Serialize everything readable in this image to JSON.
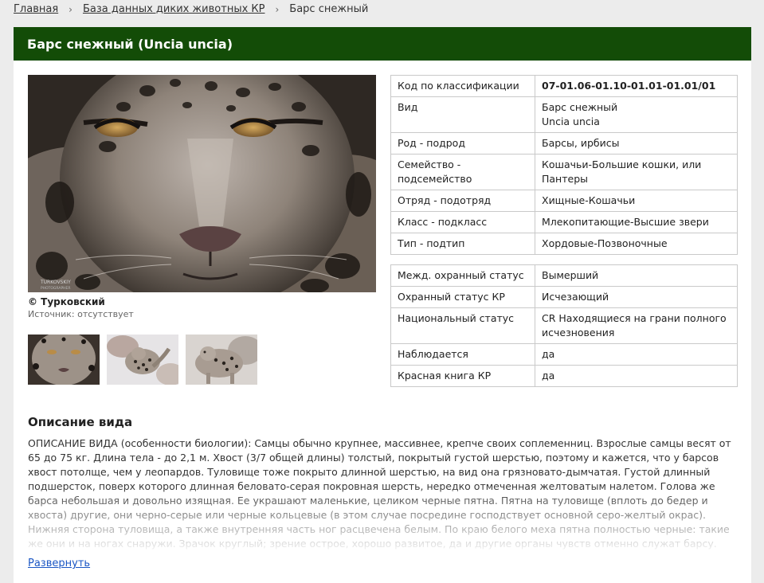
{
  "breadcrumb": {
    "home": "Главная",
    "database": "База данных диких животных КР",
    "current": "Барс снежный",
    "separator": "›"
  },
  "page_title": "Барс снежный (Uncia uncia)",
  "photo": {
    "subject": "snow-leopard",
    "watermark_line1": "TURKOVSKIY",
    "watermark_line2": "PHOTOGRAPHER",
    "author": "© Турковский",
    "source": "Источник: отсутствует",
    "thumbnails": [
      "snow-leopard-face",
      "snow-leopard-snow",
      "snow-leopard-walking"
    ]
  },
  "taxonomy": [
    {
      "key": "Код по классификации",
      "value": "07-01.06-01.10-01.01-01.01/01",
      "bold": true
    },
    {
      "key": "Вид",
      "value": "Барс снежный",
      "value2": "Uncia uncia"
    },
    {
      "key": "Род - подрод",
      "value": "Барсы, ирбисы"
    },
    {
      "key": "Семейство - подсемейство",
      "value": "Кошачьи-Большие кошки, или Пантеры"
    },
    {
      "key": "Отряд - подотряд",
      "value": "Хищные-Кошачьи"
    },
    {
      "key": "Класс - подкласс",
      "value": "Млекопитающие-Высшие звери"
    },
    {
      "key": "Тип - подтип",
      "value": "Хордовые-Позвоночные"
    }
  ],
  "status": [
    {
      "key": "Межд. охранный статус",
      "value": "Вымерший"
    },
    {
      "key": "Охранный статус КР",
      "value": "Исчезающий"
    },
    {
      "key": "Национальный статус",
      "value": "CR Находящиеся на грани полного исчезновения"
    },
    {
      "key": "Наблюдается",
      "value": "да"
    },
    {
      "key": "Красная книга КР",
      "value": "да"
    }
  ],
  "description": {
    "title": "Описание вида",
    "text": "ОПИСАНИЕ ВИДА (особенности биологии): Самцы обычно крупнее, массивнее, крепче своих соплеменниц. Взрослые самцы весят от 65 до 75 кг. Длина тела - до 2,1 м. Хвост (3/7 общей длины) толстый, покрытый густой шерстью, поэтому и кажется, что у барсов хвост потолще, чем у леопардов. Туловище тоже покрыто длинной шерстью, на вид она грязновато-дымчатая. Густой длинный подшерсток, поверх которого длинная беловато-серая покровная шерсть, нередко отмеченная желтоватым налетом. Голова же барса небольшая и довольно изящная. Ее украшают маленькие, целиком черные пятна. Пятна на туловище (вплоть до бедер и хвоста) другие, они черно-серые или черные кольцевые (в этом случае посредине господствует основной серо-желтый окрас). Нижняя сторона туловища, а также внутренняя часть ног расцвечена белым. По краю белого меха пятна полностью черные: такие же они и на ногах снаружи. Зрачок круглый; зрение острое, хорошо развитое, да и другие органы чувств отменно служат барсу.",
    "expand_label": "Развернуть"
  },
  "colors": {
    "title_bar": "#134c07",
    "background": "#ececec",
    "link": "#1a56c4",
    "border": "#c9c9c9"
  }
}
